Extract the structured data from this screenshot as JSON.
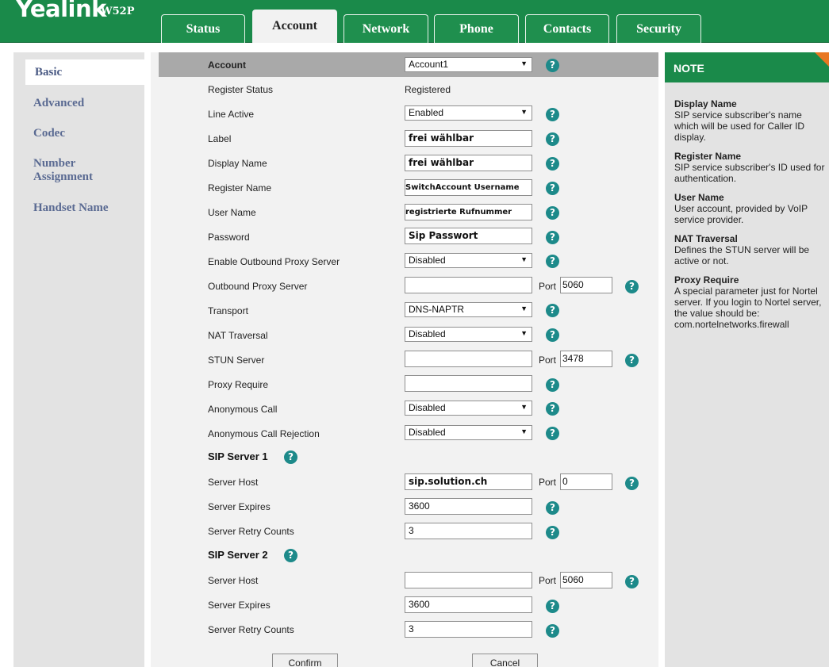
{
  "header": {
    "brand": "Yealink",
    "model": "W52P",
    "tabs": [
      {
        "label": "Status"
      },
      {
        "label": "Account"
      },
      {
        "label": "Network"
      },
      {
        "label": "Phone"
      },
      {
        "label": "Contacts"
      },
      {
        "label": "Security"
      }
    ],
    "active_tab": "Account"
  },
  "sidebar": {
    "items": [
      {
        "label": "Basic"
      },
      {
        "label": "Advanced"
      },
      {
        "label": "Codec"
      },
      {
        "label": "Number Assignment"
      },
      {
        "label": "Handset Name"
      }
    ],
    "active_item": "Basic"
  },
  "form": {
    "account": {
      "label": "Account",
      "value": "Account1"
    },
    "register_status": {
      "label": "Register Status",
      "value": "Registered"
    },
    "line_active": {
      "label": "Line Active",
      "value": "Enabled"
    },
    "label": {
      "label": "Label",
      "value": "frei wählbar"
    },
    "display_name": {
      "label": "Display Name",
      "value": "frei wählbar"
    },
    "register_name": {
      "label": "Register Name",
      "value": "SwitchAccount Username"
    },
    "user_name": {
      "label": "User Name",
      "value": "registrierte Rufnummer"
    },
    "password": {
      "label": "Password",
      "value": "Sip Passwort"
    },
    "outbound_proxy_enable": {
      "label": "Enable Outbound Proxy Server",
      "value": "Disabled"
    },
    "outbound_proxy_server": {
      "label": "Outbound Proxy Server",
      "value": "",
      "port_label": "Port",
      "port": "5060"
    },
    "transport": {
      "label": "Transport",
      "value": "DNS-NAPTR"
    },
    "nat_traversal": {
      "label": "NAT Traversal",
      "value": "Disabled"
    },
    "stun_server": {
      "label": "STUN Server",
      "value": "",
      "port_label": "Port",
      "port": "3478"
    },
    "proxy_require": {
      "label": "Proxy Require",
      "value": ""
    },
    "anonymous_call": {
      "label": "Anonymous Call",
      "value": "Disabled"
    },
    "anonymous_call_rejection": {
      "label": "Anonymous Call Rejection",
      "value": "Disabled"
    },
    "sip_server_1": {
      "title": "SIP Server 1",
      "host_label": "Server Host",
      "host": "sip.solution.ch",
      "port_label": "Port",
      "port": "0",
      "expires_label": "Server Expires",
      "expires": "3600",
      "retry_label": "Server Retry Counts",
      "retry": "3"
    },
    "sip_server_2": {
      "title": "SIP Server 2",
      "host_label": "Server Host",
      "host": "",
      "port_label": "Port",
      "port": "5060",
      "expires_label": "Server Expires",
      "expires": "3600",
      "retry_label": "Server Retry Counts",
      "retry": "3"
    },
    "help_glyph": "?",
    "buttons": {
      "confirm": "Confirm",
      "cancel": "Cancel"
    }
  },
  "note": {
    "title": "NOTE",
    "items": [
      {
        "term": "Display Name",
        "desc": "SIP service subscriber's name which will be used for Caller ID display."
      },
      {
        "term": "Register Name",
        "desc": "SIP service subscriber's ID used for authentication."
      },
      {
        "term": "User Name",
        "desc": "User account, provided by VoIP service provider."
      },
      {
        "term": "NAT Traversal",
        "desc": "Defines the STUN server will be active or not."
      },
      {
        "term": "Proxy Require",
        "desc": "A special parameter just for Nortel server. If you login to Nortel server, the value should be: com.nortelnetworks.firewall"
      }
    ]
  },
  "colors": {
    "brand_green": "#1a8a4a",
    "help_teal": "#1d8a8a",
    "note_accent": "#e87722",
    "sidebar_link": "#5a6a92"
  }
}
